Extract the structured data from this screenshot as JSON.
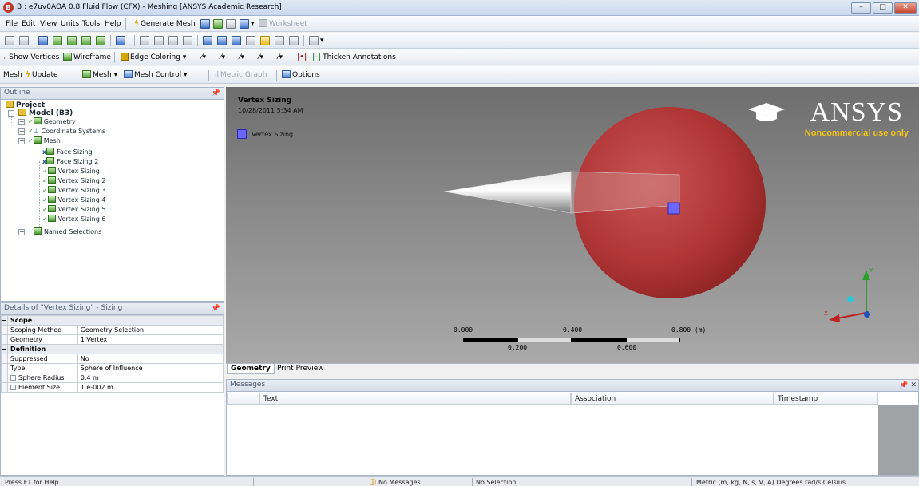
{
  "window": {
    "title": "B : e7uv0AOA 0.8 Fluid Flow (CFX) - Meshing [ANSYS Academic Research]",
    "buttons": [
      "minimize",
      "maximize",
      "close"
    ]
  },
  "menubar": {
    "items": [
      "File",
      "Edit",
      "View",
      "Units",
      "Tools",
      "Help"
    ],
    "generate_mesh": "Generate Mesh",
    "worksheet": "Worksheet"
  },
  "toolbar3": {
    "show_vertices": "Show Vertices",
    "wireframe": "Wireframe",
    "edge_coloring": "Edge Coloring",
    "thicken_annotations": "Thicken Annotations"
  },
  "contextbar": {
    "mesh": "Mesh",
    "update": "Update",
    "mesh_dropdown": "Mesh",
    "mesh_control": "Mesh Control",
    "metric_graph": "Metric Graph",
    "options": "Options"
  },
  "outline": {
    "title": "Outline",
    "tree": [
      {
        "label": "Project",
        "level": 0
      },
      {
        "label": "Model (B3)",
        "level": 1
      },
      {
        "label": "Geometry",
        "level": 2
      },
      {
        "label": "Coordinate Systems",
        "level": 2
      },
      {
        "label": "Mesh",
        "level": 2
      },
      {
        "label": "Face Sizing",
        "level": 3
      },
      {
        "label": "Face Sizing 2",
        "level": 3
      },
      {
        "label": "Vertex Sizing",
        "level": 3
      },
      {
        "label": "Vertex Sizing 2",
        "level": 3
      },
      {
        "label": "Vertex Sizing 3",
        "level": 3
      },
      {
        "label": "Vertex Sizing 4",
        "level": 3
      },
      {
        "label": "Vertex Sizing 5",
        "level": 3
      },
      {
        "label": "Vertex Sizing 6",
        "level": 3
      },
      {
        "label": "Named Selections",
        "level": 2
      }
    ]
  },
  "details": {
    "title": "Details of \"Vertex Sizing\" - Sizing",
    "sections": [
      {
        "name": "Scope",
        "rows": [
          {
            "key": "Scoping Method",
            "value": "Geometry Selection"
          },
          {
            "key": "Geometry",
            "value": "1 Vertex"
          }
        ]
      },
      {
        "name": "Definition",
        "rows": [
          {
            "key": "Suppressed",
            "value": "No"
          },
          {
            "key": "Type",
            "value": "Sphere of Influence"
          },
          {
            "key": "Sphere Radius",
            "value": "0.4 m"
          },
          {
            "key": "Element Size",
            "value": "1.e-002 m"
          }
        ]
      }
    ]
  },
  "viewport": {
    "title": "Vertex Sizing",
    "date": "10/28/2011 5:34 AM",
    "legend_label": "Vertex Sizing",
    "logo_text": "ANSYS",
    "noncommercial": "Noncommercial use only",
    "scale_top": [
      "0.000",
      "0.400",
      "0.800 (m)"
    ],
    "scale_bottom": [
      "0.200",
      "0.600"
    ],
    "axes": {
      "x": "X",
      "y": "Y"
    }
  },
  "viewtabs": [
    "Geometry",
    "Print Preview"
  ],
  "messages": {
    "title": "Messages",
    "columns": [
      "Text",
      "Association",
      "Timestamp"
    ]
  },
  "statusbar": {
    "help": "Press F1 for Help",
    "messages": "No Messages",
    "selection": "No Selection",
    "units": "Metric (m, kg, N, s, V, A)  Degrees  rad/s  Celsius"
  }
}
